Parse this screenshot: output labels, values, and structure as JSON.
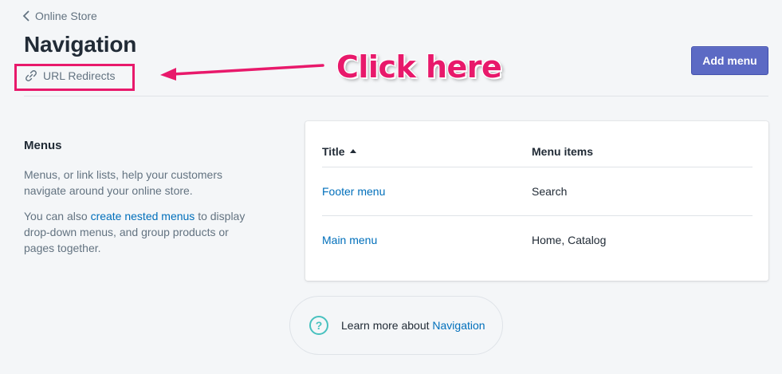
{
  "breadcrumb": {
    "label": "Online Store"
  },
  "page": {
    "title": "Navigation"
  },
  "actions": {
    "url_redirects": "URL Redirects",
    "add_menu": "Add menu"
  },
  "annotation": {
    "text": "Click here",
    "color": "#e8196b"
  },
  "section": {
    "heading": "Menus",
    "description_1": "Menus, or link lists, help your customers navigate around your online store.",
    "description_2_before": "You can also ",
    "description_2_link": "create nested menus",
    "description_2_after": " to display drop-down menus, and group products or pages together."
  },
  "table": {
    "headers": {
      "title": "Title",
      "items": "Menu items"
    },
    "rows": [
      {
        "title": "Footer menu",
        "items": "Search"
      },
      {
        "title": "Main menu",
        "items": "Home, Catalog"
      }
    ]
  },
  "footer_help": {
    "text": "Learn more about ",
    "link": "Navigation",
    "icon": "question-circle-icon"
  },
  "colors": {
    "primary": "#5c6ac4",
    "link": "#006fbb",
    "help_icon": "#47c1bf"
  }
}
